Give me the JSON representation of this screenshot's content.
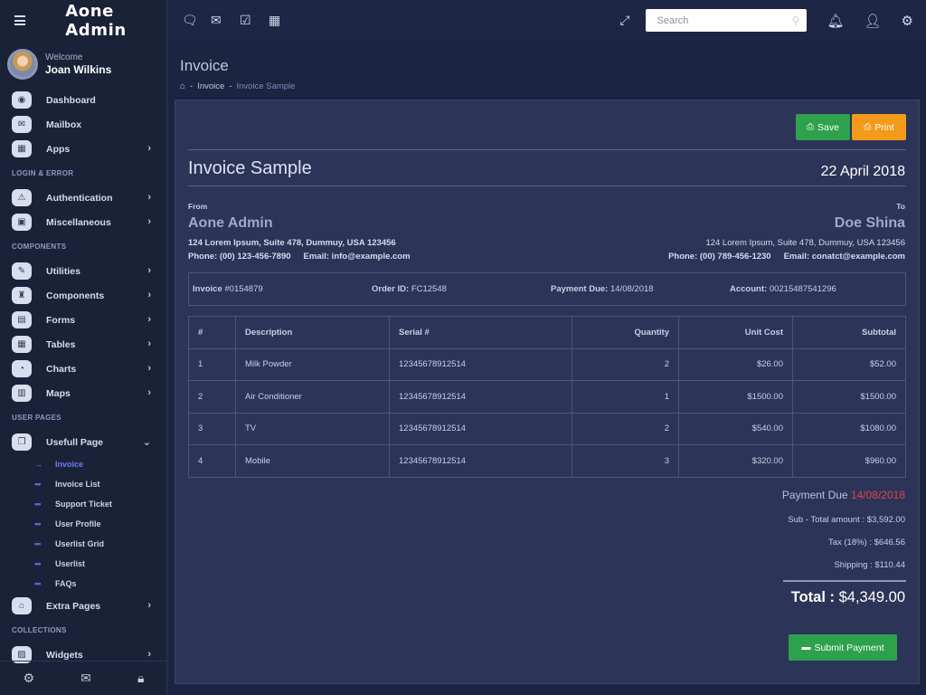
{
  "brand": "Aone  Admin",
  "user": {
    "welcome": "Welcome",
    "name": "Joan Wilkins"
  },
  "sidebar": {
    "nav1": [
      {
        "label": "Dashboard",
        "icon": "eye-icon",
        "glyph": "◉",
        "chevron": false
      },
      {
        "label": "Mailbox",
        "icon": "mail-icon",
        "glyph": "✉",
        "chevron": false
      },
      {
        "label": "Apps",
        "icon": "grid-icon",
        "glyph": "▦",
        "chevron": true
      }
    ],
    "section_login": "LOGIN & ERROR",
    "nav2": [
      {
        "label": "Authentication",
        "icon": "warning-icon",
        "glyph": "⚠",
        "chevron": true
      },
      {
        "label": "Miscellaneous",
        "icon": "lock-icon",
        "glyph": "▣",
        "chevron": true
      }
    ],
    "section_components": "COMPONENTS",
    "nav3": [
      {
        "label": "Utilities",
        "icon": "edit-icon",
        "glyph": "✎",
        "chevron": true
      },
      {
        "label": "Components",
        "icon": "trophy-icon",
        "glyph": "♜",
        "chevron": true
      },
      {
        "label": "Forms",
        "icon": "file-icon",
        "glyph": "▤",
        "chevron": true
      },
      {
        "label": "Tables",
        "icon": "table-icon",
        "glyph": "▦",
        "chevron": true
      },
      {
        "label": "Charts",
        "icon": "pie-chart-icon",
        "glyph": "◔",
        "chevron": true
      },
      {
        "label": "Maps",
        "icon": "map-icon",
        "glyph": "▥",
        "chevron": true
      }
    ],
    "section_user": "USER PAGES",
    "usefull": {
      "label": "Usefull Page",
      "icon": "copy-icon",
      "glyph": "❐"
    },
    "sub_items": [
      "Invoice",
      "Invoice List",
      "Support Ticket",
      "User Profile",
      "Userlist Grid",
      "Userlist",
      "FAQs"
    ],
    "extra": {
      "label": "Extra Pages",
      "icon": "basket-icon",
      "glyph": "⌂"
    },
    "section_collections": "COLLECTIONS",
    "widgets": {
      "label": "Widgets",
      "icon": "widget-icon",
      "glyph": "▨"
    },
    "chevron": "›",
    "chevron_open": "⌄",
    "sub_active_glyph": "→",
    "sub_glyph": "•••"
  },
  "topbar": {
    "search_placeholder": "Search"
  },
  "page": {
    "title": "Invoice",
    "breadcrumb_home": "⌂",
    "breadcrumb_sep": "-",
    "breadcrumb_1": "Invoice",
    "breadcrumb_2": "Invoice Sample"
  },
  "invoice": {
    "save_label": "Save",
    "print_label": "Print",
    "title": "Invoice Sample",
    "date": "22 April 2018",
    "from_label": "From",
    "to_label": "To",
    "from_name": "Aone Admin",
    "to_name": "Doe Shina",
    "from_address": "124 Lorem Ipsum, Suite 478, Dummuy, USA 123456",
    "to_address": "124 Lorem Ipsum, Suite 478, Dummuy, USA 123456",
    "from_phone": "Phone: (00) 123-456-7890",
    "from_email": "Email: info@example.com",
    "to_phone": "Phone: (00) 789-456-1230",
    "to_email": "Email: conatct@example.com",
    "meta": {
      "invoice_label": "Invoice",
      "invoice_value": "#0154879",
      "order_label": "Order ID:",
      "order_value": "FC12548",
      "due_label": "Payment Due:",
      "due_value": "14/08/2018",
      "account_label": "Account:",
      "account_value": "00215487541296"
    },
    "columns": [
      "#",
      "Description",
      "Serial #",
      "Quantity",
      "Unit Cost",
      "Subtotal"
    ],
    "rows": [
      [
        "1",
        "Milk Powder",
        "12345678912514",
        "2",
        "$26.00",
        "$52.00"
      ],
      [
        "2",
        "Air Conditioner",
        "12345678912514",
        "1",
        "$1500.00",
        "$1500.00"
      ],
      [
        "3",
        "TV",
        "12345678912514",
        "2",
        "$540.00",
        "$1080.00"
      ],
      [
        "4",
        "Mobile",
        "12345678912514",
        "3",
        "$320.00",
        "$960.00"
      ]
    ],
    "payment_due_label": "Payment Due",
    "payment_due_date": "14/08/2018",
    "subtotal_line": "Sub - Total amount : $3,592.00",
    "tax_line": "Tax (18%) : $646.56",
    "shipping_line": "Shipping : $110.44",
    "total_label": "Total :",
    "total_value": "$4,349.00",
    "submit_label": "Submit Payment"
  },
  "colors": {
    "accent_green": "#2ea14d",
    "accent_orange": "#f39a1b",
    "due_red": "#e0414e",
    "active_blue": "#6f7bf7"
  }
}
